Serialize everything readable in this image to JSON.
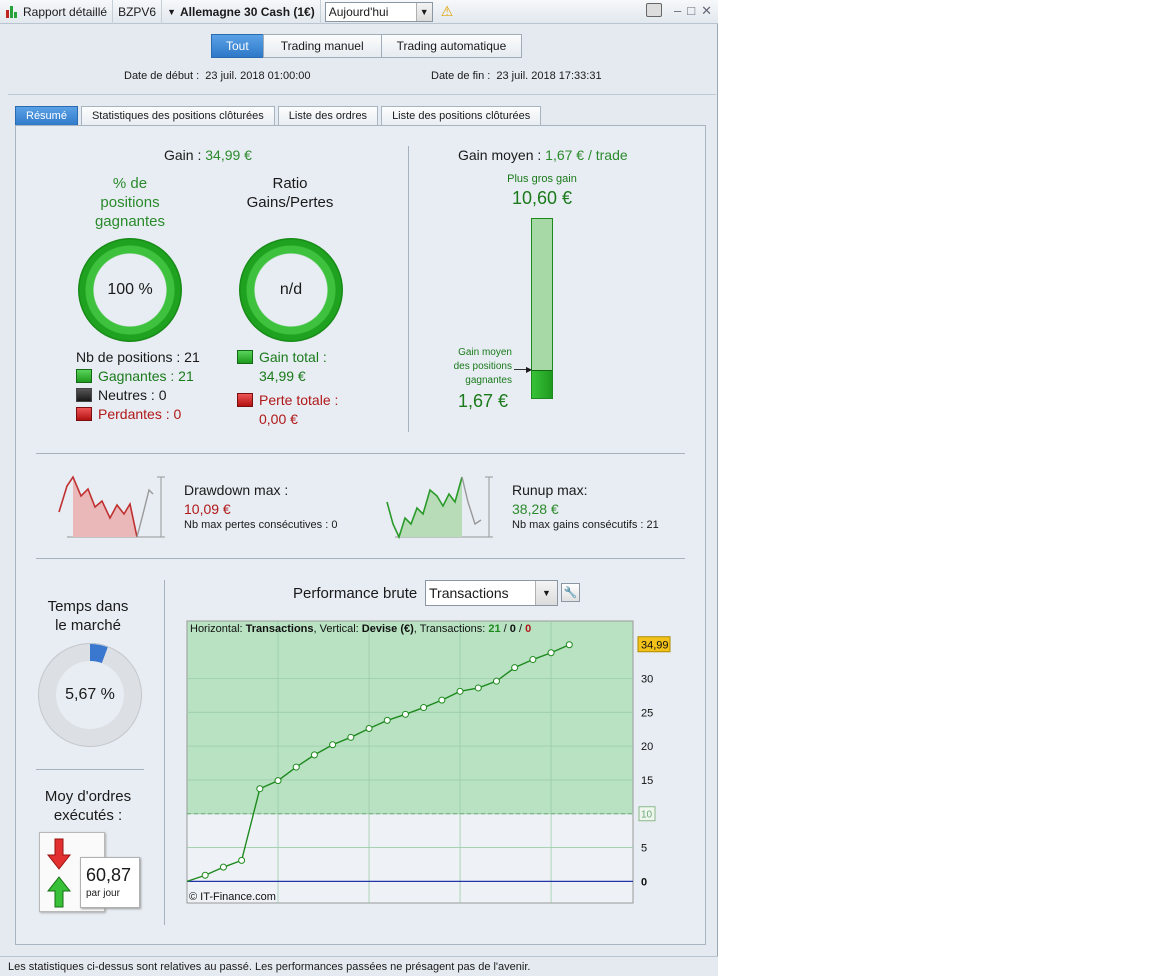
{
  "titlebar": {
    "report": "Rapport détaillé",
    "account": "BZPV6",
    "instrument": "Allemagne 30 Cash (1€)",
    "period": "Aujourd'hui"
  },
  "modes": [
    "Tout",
    "Trading manuel",
    "Trading automatique"
  ],
  "dates": {
    "start_label": "Date de début :",
    "start_value": "23 juil. 2018 01:00:00",
    "end_label": "Date de fin :",
    "end_value": "23 juil. 2018 17:33:31"
  },
  "tabs": [
    "Résumé",
    "Statistiques des positions clôturées",
    "Liste des ordres",
    "Liste des positions clôturées"
  ],
  "summary": {
    "gain_label": "Gain :",
    "gain_value": "34,99 €",
    "winrate_title_1": "% de",
    "winrate_title_2": "positions",
    "winrate_title_3": "gagnantes",
    "winrate_value": "100 %",
    "ratio_title_1": "Ratio",
    "ratio_title_2": "Gains/Pertes",
    "ratio_value": "n/d",
    "positions_label": "Nb de positions : 21",
    "winners": "Gagnantes : 21",
    "neutral": "Neutres : 0",
    "losers": "Perdantes : 0",
    "gain_total_label": "Gain total :",
    "gain_total_value": "34,99 €",
    "loss_total_label": "Perte totale :",
    "loss_total_value": "0,00 €",
    "avg_gain_label": "Gain moyen :",
    "avg_gain_value": "1,67 € / trade",
    "biggest_gain_label": "Plus gros gain",
    "biggest_gain_value": "10,60 €",
    "avg_win_label_1": "Gain moyen",
    "avg_win_label_2": "des positions",
    "avg_win_label_3": "gagnantes",
    "avg_win_value": "1,67 €",
    "avg_bar_fraction": 0.158
  },
  "drawdown": {
    "label": "Drawdown max :",
    "value": "10,09 €",
    "sub": "Nb max pertes consécutives : 0"
  },
  "runup": {
    "label": "Runup max:",
    "value": "38,28 €",
    "sub": "Nb max gains consécutifs : 21"
  },
  "market_time": {
    "title_1": "Temps dans",
    "title_2": "le marché",
    "value": "5,67 %",
    "fraction": 0.0567
  },
  "orders": {
    "title_1": "Moy d'ordres",
    "title_2": "exécutés :",
    "value": "60,87",
    "unit": "par jour"
  },
  "performance": {
    "title": "Performance brute",
    "mode": "Transactions",
    "info_prefix": "Horizontal: ",
    "info_h": "Transactions",
    "info_mid": ", Vertical: ",
    "info_v": "Devise (€)",
    "info_tr": ", Transactions: ",
    "info_n1": "21",
    "info_sep1": " / ",
    "info_n2": "0",
    "info_sep2": " / ",
    "info_n3": "0",
    "copyright": "© IT-Finance.com",
    "last_value_tag": "34,99",
    "threshold_tag": "10"
  },
  "chart_data": {
    "type": "line",
    "title": "Performance brute",
    "xlabel": "Transactions",
    "ylabel": "Devise (€)",
    "x": [
      0,
      1,
      2,
      3,
      4,
      5,
      6,
      7,
      8,
      9,
      10,
      11,
      12,
      13,
      14,
      15,
      16,
      17,
      18,
      19,
      20,
      21
    ],
    "series": [
      {
        "values": [
          0,
          0.9,
          2.1,
          3.1,
          13.7,
          14.9,
          16.9,
          18.7,
          20.2,
          21.3,
          22.6,
          23.8,
          24.7,
          25.7,
          26.8,
          28.1,
          28.6,
          29.6,
          31.6,
          32.8,
          33.8,
          34.99
        ]
      }
    ],
    "xticks": [
      5,
      10,
      15,
      20
    ],
    "yticks": [
      0,
      5,
      10,
      15,
      20,
      25,
      30
    ],
    "xlim": [
      0,
      24.5
    ],
    "ylim": [
      -3.2,
      38.5
    ],
    "threshold": 10,
    "grid": true
  },
  "footer": "Les statistiques ci-dessus sont relatives au passé. Les performances passées ne présagent pas de l'avenir."
}
